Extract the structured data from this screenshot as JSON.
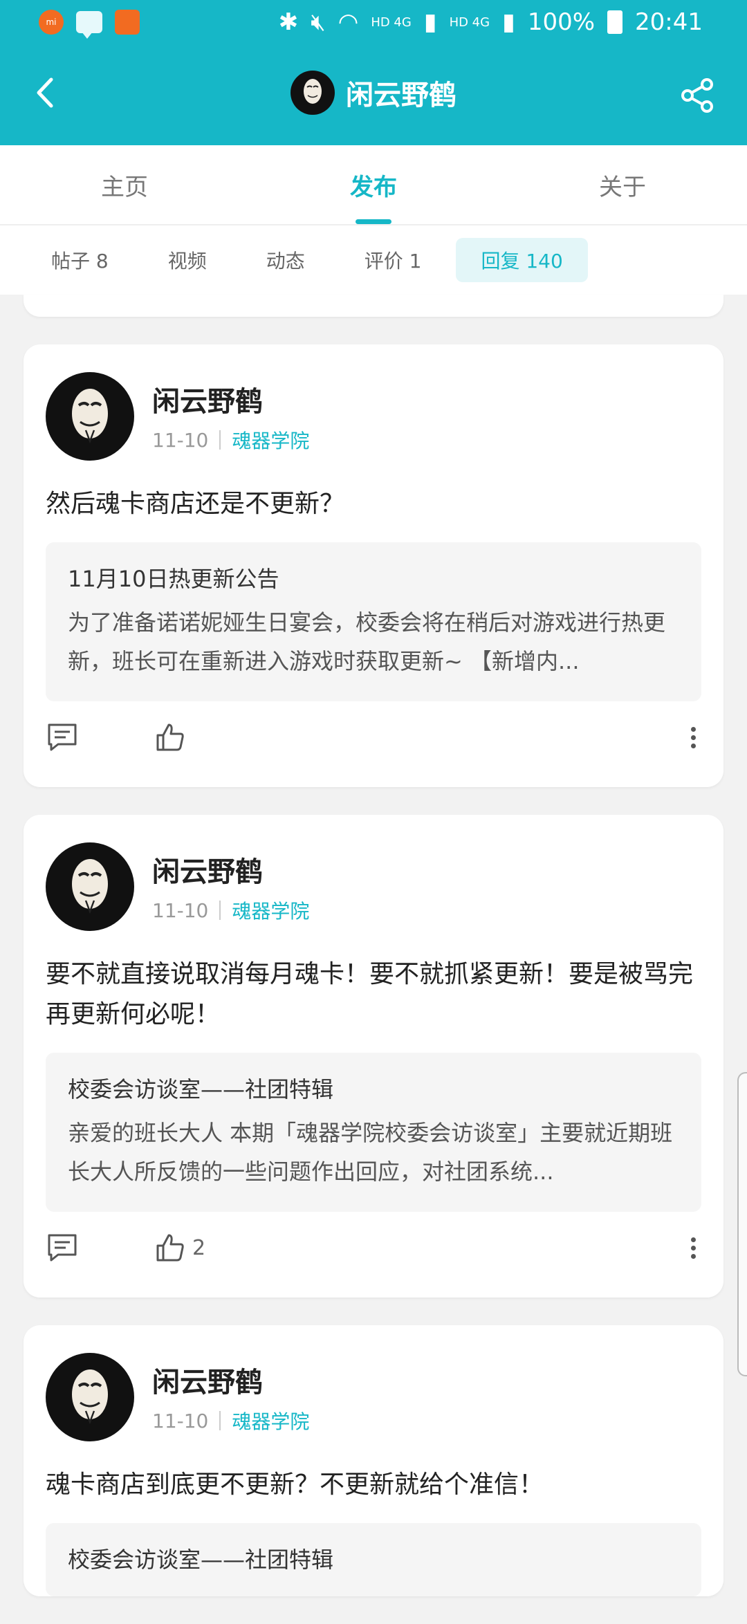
{
  "status_bar": {
    "notif_label": "mi",
    "network_label_1": "HD 4G",
    "network_label_2": "HD 4G",
    "battery": "100%",
    "time": "20:41"
  },
  "app_bar": {
    "title": "闲云野鹤"
  },
  "tabs": [
    {
      "label": "主页",
      "active": false
    },
    {
      "label": "发布",
      "active": true
    },
    {
      "label": "关于",
      "active": false
    }
  ],
  "subtabs": [
    {
      "label": "帖子 8"
    },
    {
      "label": "视频"
    },
    {
      "label": "动态"
    },
    {
      "label": "评价 1"
    },
    {
      "label": "回复 140"
    }
  ],
  "posts": [
    {
      "author": "闲云野鹤",
      "date": "11-10",
      "forum": "魂器学院",
      "content": "然后魂卡商店还是不更新？",
      "quote_title": "11月10日热更新公告",
      "quote_body": "为了准备诺诺妮娅生日宴会，校委会将在稍后对游戏进行热更新，班长可在重新进入游戏时获取更新~ 【新增内...",
      "likes": ""
    },
    {
      "author": "闲云野鹤",
      "date": "11-10",
      "forum": "魂器学院",
      "content": "要不就直接说取消每月魂卡！要不就抓紧更新！要是被骂完再更新何必呢！",
      "quote_title": "校委会访谈室——社团特辑",
      "quote_body": "亲爱的班长大人  本期「魂器学院校委会访谈室」主要就近期班长大人所反馈的一些问题作出回应，对社团系统...",
      "likes": "2"
    },
    {
      "author": "闲云野鹤",
      "date": "11-10",
      "forum": "魂器学院",
      "content": "魂卡商店到底更不更新？不更新就给个准信！",
      "quote_title": "校委会访谈室——社团特辑"
    }
  ]
}
